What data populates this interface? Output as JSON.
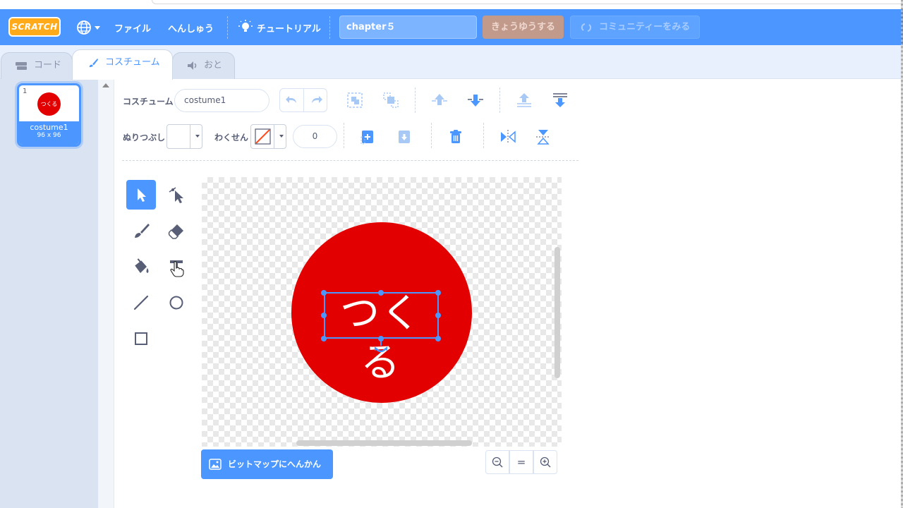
{
  "menubar": {
    "logo": "SCRATCH",
    "file": "ファイル",
    "edit": "へんしゅう",
    "tutorial": "チュートリアル",
    "project_title": "chapter５",
    "share": "きょうゆうする",
    "community": "コミュニティーをみる"
  },
  "tabs": {
    "code": "コード",
    "costumes": "コスチューム",
    "sounds": "おと"
  },
  "costumes": [
    {
      "number": "1",
      "name": "costume1",
      "size": "96 x 96",
      "thumb_text": "つくる"
    }
  ],
  "editor": {
    "costume_label": "コスチューム",
    "costume_name": "costume1",
    "fill_label": "ぬりつぶし",
    "outline_label": "わくせん",
    "outline_width": "0",
    "convert_button": "ビットマップにへんかん",
    "zoom_reset": "="
  },
  "canvas": {
    "text": "つくる",
    "circle_color": "#e30000"
  },
  "colors": {
    "accent": "#4c97ff",
    "menubar": "#4c97ff",
    "share": "#c19a8b"
  }
}
